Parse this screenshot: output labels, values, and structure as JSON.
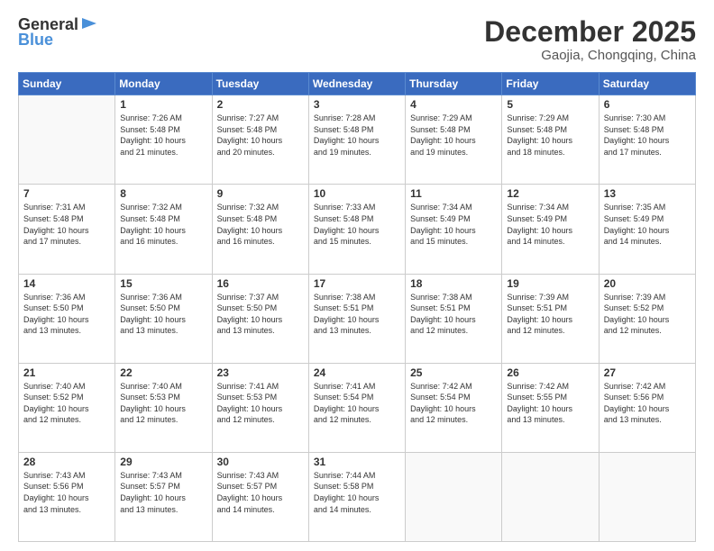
{
  "header": {
    "logo_general": "General",
    "logo_blue": "Blue",
    "title": "December 2025",
    "subtitle": "Gaojia, Chongqing, China"
  },
  "days_of_week": [
    "Sunday",
    "Monday",
    "Tuesday",
    "Wednesday",
    "Thursday",
    "Friday",
    "Saturday"
  ],
  "weeks": [
    [
      {
        "day": "",
        "info": ""
      },
      {
        "day": "1",
        "info": "Sunrise: 7:26 AM\nSunset: 5:48 PM\nDaylight: 10 hours\nand 21 minutes."
      },
      {
        "day": "2",
        "info": "Sunrise: 7:27 AM\nSunset: 5:48 PM\nDaylight: 10 hours\nand 20 minutes."
      },
      {
        "day": "3",
        "info": "Sunrise: 7:28 AM\nSunset: 5:48 PM\nDaylight: 10 hours\nand 19 minutes."
      },
      {
        "day": "4",
        "info": "Sunrise: 7:29 AM\nSunset: 5:48 PM\nDaylight: 10 hours\nand 19 minutes."
      },
      {
        "day": "5",
        "info": "Sunrise: 7:29 AM\nSunset: 5:48 PM\nDaylight: 10 hours\nand 18 minutes."
      },
      {
        "day": "6",
        "info": "Sunrise: 7:30 AM\nSunset: 5:48 PM\nDaylight: 10 hours\nand 17 minutes."
      }
    ],
    [
      {
        "day": "7",
        "info": "Sunrise: 7:31 AM\nSunset: 5:48 PM\nDaylight: 10 hours\nand 17 minutes."
      },
      {
        "day": "8",
        "info": "Sunrise: 7:32 AM\nSunset: 5:48 PM\nDaylight: 10 hours\nand 16 minutes."
      },
      {
        "day": "9",
        "info": "Sunrise: 7:32 AM\nSunset: 5:48 PM\nDaylight: 10 hours\nand 16 minutes."
      },
      {
        "day": "10",
        "info": "Sunrise: 7:33 AM\nSunset: 5:48 PM\nDaylight: 10 hours\nand 15 minutes."
      },
      {
        "day": "11",
        "info": "Sunrise: 7:34 AM\nSunset: 5:49 PM\nDaylight: 10 hours\nand 15 minutes."
      },
      {
        "day": "12",
        "info": "Sunrise: 7:34 AM\nSunset: 5:49 PM\nDaylight: 10 hours\nand 14 minutes."
      },
      {
        "day": "13",
        "info": "Sunrise: 7:35 AM\nSunset: 5:49 PM\nDaylight: 10 hours\nand 14 minutes."
      }
    ],
    [
      {
        "day": "14",
        "info": "Sunrise: 7:36 AM\nSunset: 5:50 PM\nDaylight: 10 hours\nand 13 minutes."
      },
      {
        "day": "15",
        "info": "Sunrise: 7:36 AM\nSunset: 5:50 PM\nDaylight: 10 hours\nand 13 minutes."
      },
      {
        "day": "16",
        "info": "Sunrise: 7:37 AM\nSunset: 5:50 PM\nDaylight: 10 hours\nand 13 minutes."
      },
      {
        "day": "17",
        "info": "Sunrise: 7:38 AM\nSunset: 5:51 PM\nDaylight: 10 hours\nand 13 minutes."
      },
      {
        "day": "18",
        "info": "Sunrise: 7:38 AM\nSunset: 5:51 PM\nDaylight: 10 hours\nand 12 minutes."
      },
      {
        "day": "19",
        "info": "Sunrise: 7:39 AM\nSunset: 5:51 PM\nDaylight: 10 hours\nand 12 minutes."
      },
      {
        "day": "20",
        "info": "Sunrise: 7:39 AM\nSunset: 5:52 PM\nDaylight: 10 hours\nand 12 minutes."
      }
    ],
    [
      {
        "day": "21",
        "info": "Sunrise: 7:40 AM\nSunset: 5:52 PM\nDaylight: 10 hours\nand 12 minutes."
      },
      {
        "day": "22",
        "info": "Sunrise: 7:40 AM\nSunset: 5:53 PM\nDaylight: 10 hours\nand 12 minutes."
      },
      {
        "day": "23",
        "info": "Sunrise: 7:41 AM\nSunset: 5:53 PM\nDaylight: 10 hours\nand 12 minutes."
      },
      {
        "day": "24",
        "info": "Sunrise: 7:41 AM\nSunset: 5:54 PM\nDaylight: 10 hours\nand 12 minutes."
      },
      {
        "day": "25",
        "info": "Sunrise: 7:42 AM\nSunset: 5:54 PM\nDaylight: 10 hours\nand 12 minutes."
      },
      {
        "day": "26",
        "info": "Sunrise: 7:42 AM\nSunset: 5:55 PM\nDaylight: 10 hours\nand 13 minutes."
      },
      {
        "day": "27",
        "info": "Sunrise: 7:42 AM\nSunset: 5:56 PM\nDaylight: 10 hours\nand 13 minutes."
      }
    ],
    [
      {
        "day": "28",
        "info": "Sunrise: 7:43 AM\nSunset: 5:56 PM\nDaylight: 10 hours\nand 13 minutes."
      },
      {
        "day": "29",
        "info": "Sunrise: 7:43 AM\nSunset: 5:57 PM\nDaylight: 10 hours\nand 13 minutes."
      },
      {
        "day": "30",
        "info": "Sunrise: 7:43 AM\nSunset: 5:57 PM\nDaylight: 10 hours\nand 14 minutes."
      },
      {
        "day": "31",
        "info": "Sunrise: 7:44 AM\nSunset: 5:58 PM\nDaylight: 10 hours\nand 14 minutes."
      },
      {
        "day": "",
        "info": ""
      },
      {
        "day": "",
        "info": ""
      },
      {
        "day": "",
        "info": ""
      }
    ]
  ]
}
